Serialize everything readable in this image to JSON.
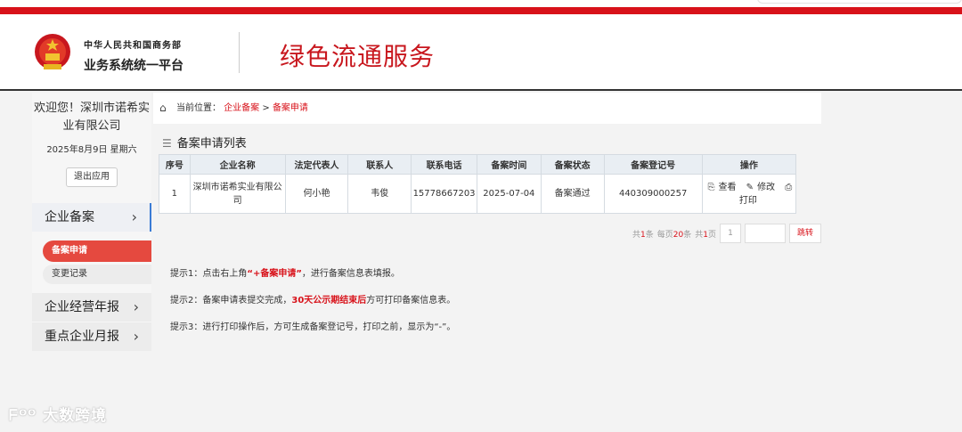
{
  "header": {
    "org": "中华人民共和国商务部",
    "platform": "业务系统统一平台",
    "service": "绿色流通服务"
  },
  "sidebar": {
    "welcome": "欢迎您！深圳市诺希实业有限公司",
    "date": "2025年8月9日 星期六",
    "logout": "退出应用",
    "menu": [
      {
        "label": "企业备案",
        "chev": "›"
      },
      {
        "label": "企业经营年报",
        "chev": "›"
      },
      {
        "label": "重点企业月报",
        "chev": "›"
      }
    ],
    "submenu": [
      "备案申请",
      "变更记录"
    ]
  },
  "breadcrumb": {
    "prefix": "当前位置：",
    "link1": "企业备案",
    "sep": " > ",
    "link2": "备案申请"
  },
  "list": {
    "title": "备案申请列表",
    "columns": [
      "序号",
      "企业名称",
      "法定代表人",
      "联系人",
      "联系电话",
      "备案时间",
      "备案状态",
      "备案登记号",
      "操作"
    ],
    "rows": [
      {
        "no": "1",
        "company": "深圳市诺希实业有限公司",
        "legal": "何小艳",
        "contact": "韦俊",
        "phone": "15778667203",
        "date": "2025-07-04",
        "status": "备案通过",
        "regno": "440309000257",
        "op_view": "查看",
        "op_edit": "修改",
        "op_print": "打印"
      }
    ]
  },
  "pager": {
    "total_prefix": "共",
    "total": "1",
    "total_suffix": "条",
    "per_prefix": "每页",
    "per": "20",
    "per_suffix": "条",
    "pages_prefix": "共",
    "pages": "1",
    "pages_suffix": "页",
    "current": "1",
    "go": "跳转"
  },
  "tips": {
    "t1_a": "提示1：点击右上角",
    "t1_hl": "“+备案申请”",
    "t1_b": "，进行备案信息表填报。",
    "t2_a": "提示2：备案申请表提交完成，",
    "t2_hl": "30天公示期结束后",
    "t2_b": "方可打印备案信息表。",
    "t3": "提示3：进行打印操作后，方可生成备案登记号，打印之前，显示为“-”。"
  },
  "watermark": "大数跨境"
}
